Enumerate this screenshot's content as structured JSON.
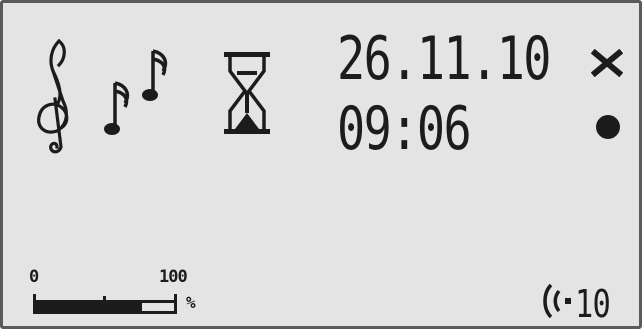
{
  "display": {
    "date": "26.11.10",
    "time": "09:06",
    "signal": {
      "icon": "signal-strength-icon",
      "value": "10"
    }
  },
  "icons": {
    "music": [
      "treble-clef-icon",
      "music-notes-icon"
    ],
    "timer": "hourglass-icon",
    "close": "close-icon",
    "status": "record-dot-icon"
  },
  "level_meter": {
    "min_label": "0",
    "max_label": "100",
    "unit": "%",
    "level_fraction": 0.77
  },
  "colors": {
    "lcd_background": "#e4e4e4",
    "lcd_ink": "#1c1c1c",
    "frame": "#5a5a5a"
  }
}
